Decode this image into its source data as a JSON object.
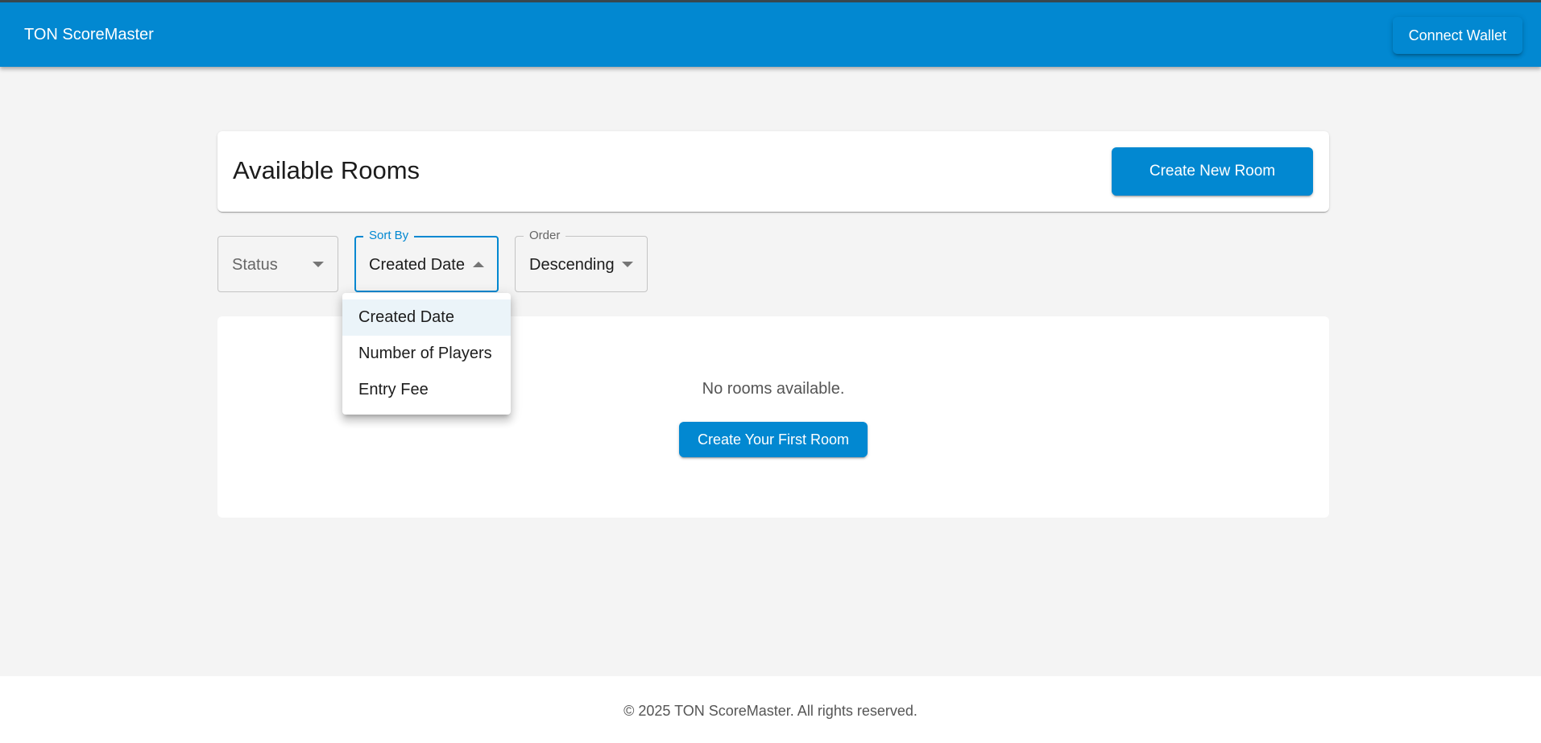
{
  "app": {
    "brand": "TON ScoreMaster",
    "connect_wallet_label": "Connect Wallet"
  },
  "header": {
    "title": "Available Rooms",
    "create_new_room_label": "Create New Room"
  },
  "filters": {
    "status": {
      "placeholder": "Status",
      "value": ""
    },
    "sort_by": {
      "label": "Sort By",
      "value": "Created Date",
      "open": true,
      "options": [
        "Created Date",
        "Number of Players",
        "Entry Fee"
      ]
    },
    "order": {
      "label": "Order",
      "value": "Descending"
    }
  },
  "content": {
    "empty_message": "No rooms available.",
    "create_first_room_label": "Create Your First Room"
  },
  "footer": {
    "copyright": "© 2025 TON ScoreMaster. All rights reserved."
  },
  "colors": {
    "primary": "#0288d1",
    "appbar_border": "#37474f",
    "background": "#f4f4f4",
    "menu_selected": "#ebf4f9"
  }
}
